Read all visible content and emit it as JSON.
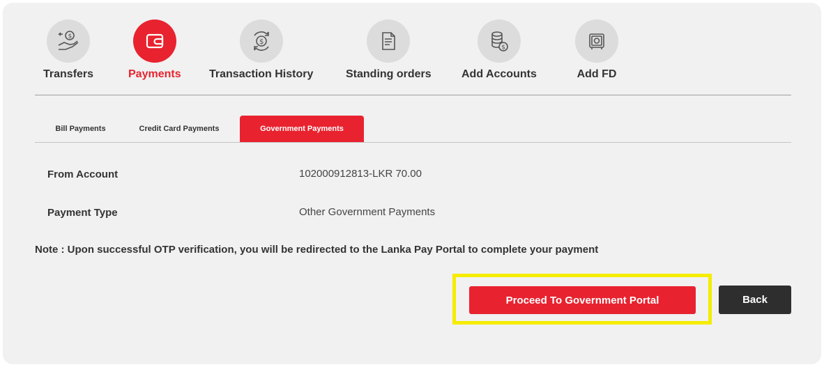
{
  "nav": {
    "items": [
      {
        "label": "Transfers",
        "icon": "money-transfer-icon"
      },
      {
        "label": "Payments",
        "icon": "wallet-icon",
        "active": true
      },
      {
        "label": "Transaction History",
        "icon": "exchange-icon"
      },
      {
        "label": "Standing orders",
        "icon": "document-icon"
      },
      {
        "label": "Add Accounts",
        "icon": "coins-icon"
      },
      {
        "label": "Add FD",
        "icon": "safe-icon"
      }
    ]
  },
  "subtabs": [
    {
      "label": "Bill Payments"
    },
    {
      "label": "Credit Card Payments"
    },
    {
      "label": "Government Payments",
      "active": true
    }
  ],
  "form": {
    "from_account_label": "From Account",
    "from_account_value": "102000912813-LKR 70.00",
    "payment_type_label": "Payment Type",
    "payment_type_value": "Other Government Payments"
  },
  "note": "Note : Upon successful OTP verification, you will be redirected to the Lanka Pay Portal to complete your payment",
  "buttons": {
    "proceed_label": "Proceed To Government Portal",
    "back_label": "Back"
  },
  "colors": {
    "accent": "#e8232f",
    "highlight": "#f5ec00",
    "back_button": "#2e2e2e",
    "card_bg": "#f1f1f1"
  }
}
